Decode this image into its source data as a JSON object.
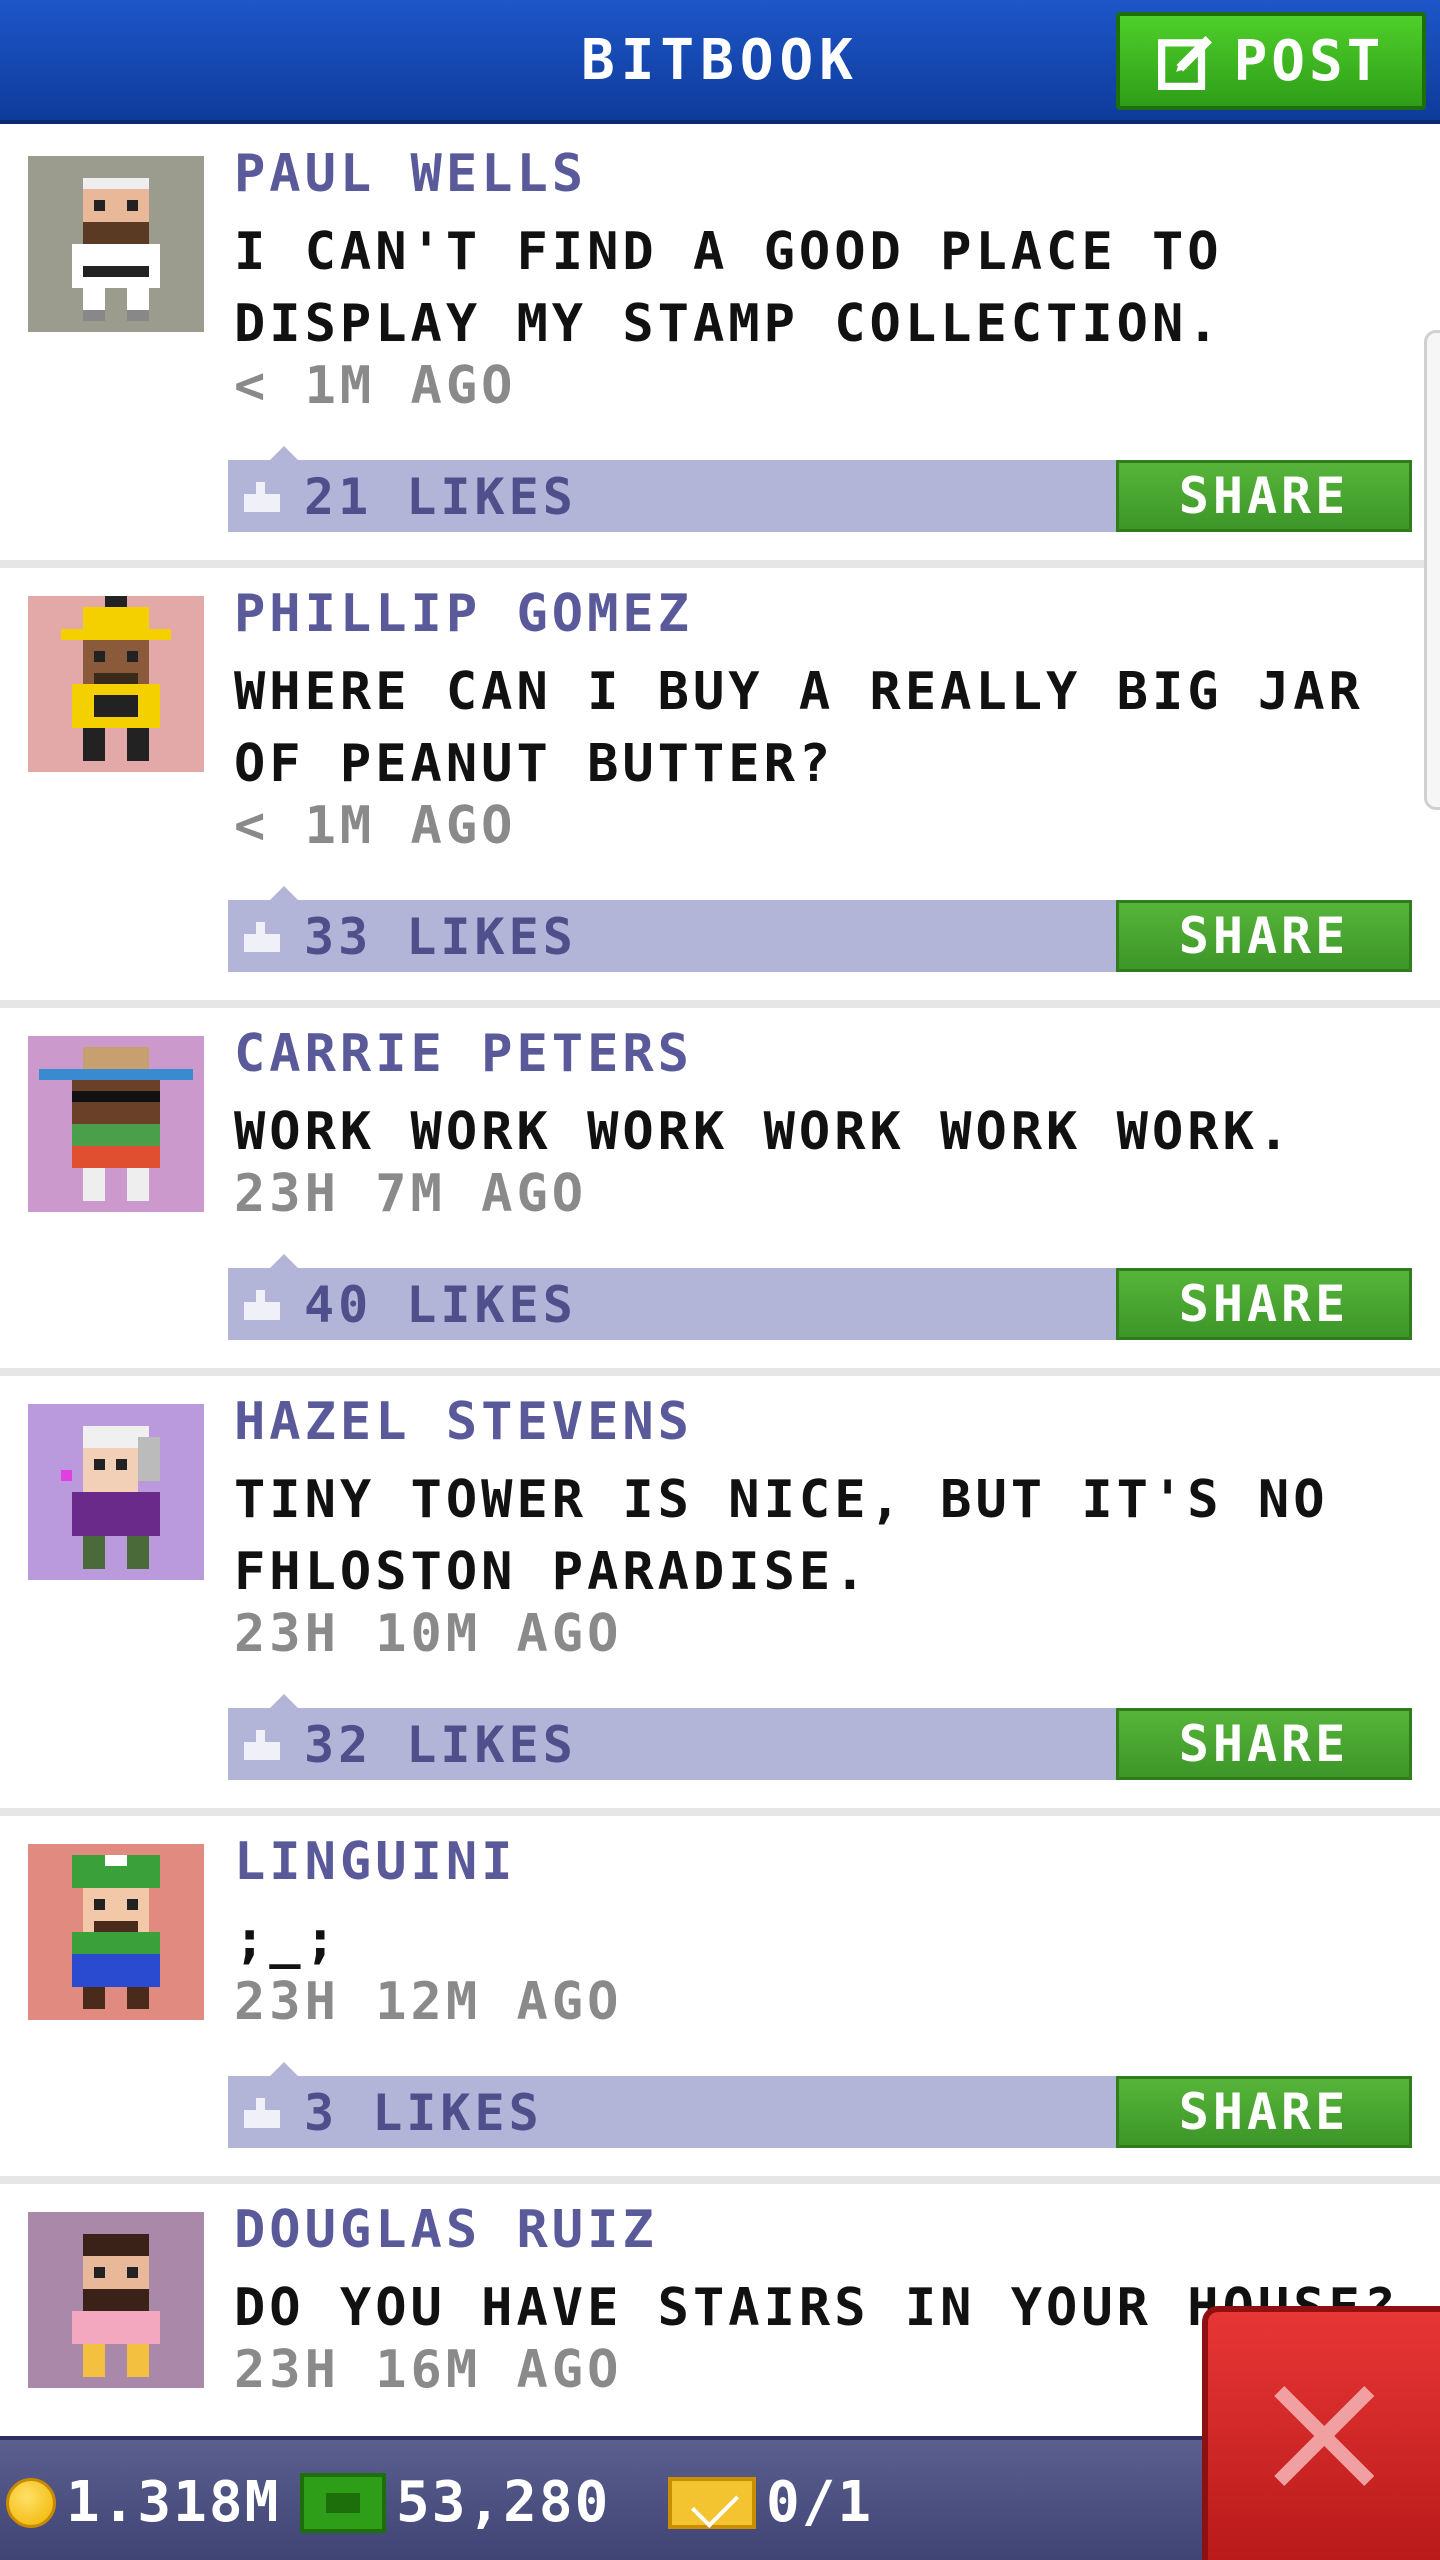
{
  "header": {
    "title": "BITBOOK",
    "post_label": "POST"
  },
  "colors": {
    "header_blue": "#1e56c8",
    "post_green": "#3fb820",
    "likes_bar": "#b3b5d8",
    "author_purple": "#5a5a9a",
    "close_red": "#d92a2a"
  },
  "posts": [
    {
      "author": "PAUL WELLS",
      "message": "I CAN'T FIND A GOOD PLACE TO DISPLAY MY STAMP COLLECTION.",
      "time": "< 1M AGO",
      "likes": "21 LIKES",
      "share": "SHARE",
      "avatar_bg": "#9c9c8e",
      "avatar_icon": "karate-man-avatar"
    },
    {
      "author": "PHILLIP GOMEZ",
      "message": "WHERE CAN I BUY A REALLY BIG JAR OF PEANUT BUTTER?",
      "time": "< 1M AGO",
      "likes": "33 LIKES",
      "share": "SHARE",
      "avatar_bg": "#e3a9a9",
      "avatar_icon": "sombrero-man-avatar"
    },
    {
      "author": "CARRIE PETERS",
      "message": "WORK WORK WORK WORK WORK WORK.",
      "time": "23H 7M AGO",
      "likes": "40 LIKES",
      "share": "SHARE",
      "avatar_bg": "#cc99cc",
      "avatar_icon": "sunglasses-woman-avatar"
    },
    {
      "author": "HAZEL STEVENS",
      "message": "TINY TOWER IS NICE, BUT IT'S NO FHLOSTON PARADISE.",
      "time": "23H 10M AGO",
      "likes": "32 LIKES",
      "share": "SHARE",
      "avatar_bg": "#bb99dd",
      "avatar_icon": "old-woman-avatar"
    },
    {
      "author": "LINGUINI",
      "message": ";_;",
      "time": "23H 12M AGO",
      "likes": "3 LIKES",
      "share": "SHARE",
      "avatar_bg": "#e08a80",
      "avatar_icon": "plumber-avatar"
    },
    {
      "author": "DOUGLAS RUIZ",
      "message": "DO YOU HAVE STAIRS IN YOUR HOUSE?",
      "time": "23H 16M AGO",
      "avatar_bg": "#aa88aa",
      "avatar_icon": "bearded-man-avatar"
    }
  ],
  "bottom_bar": {
    "coins": "1.318M",
    "bux": "53,280",
    "vip": "0/1"
  }
}
